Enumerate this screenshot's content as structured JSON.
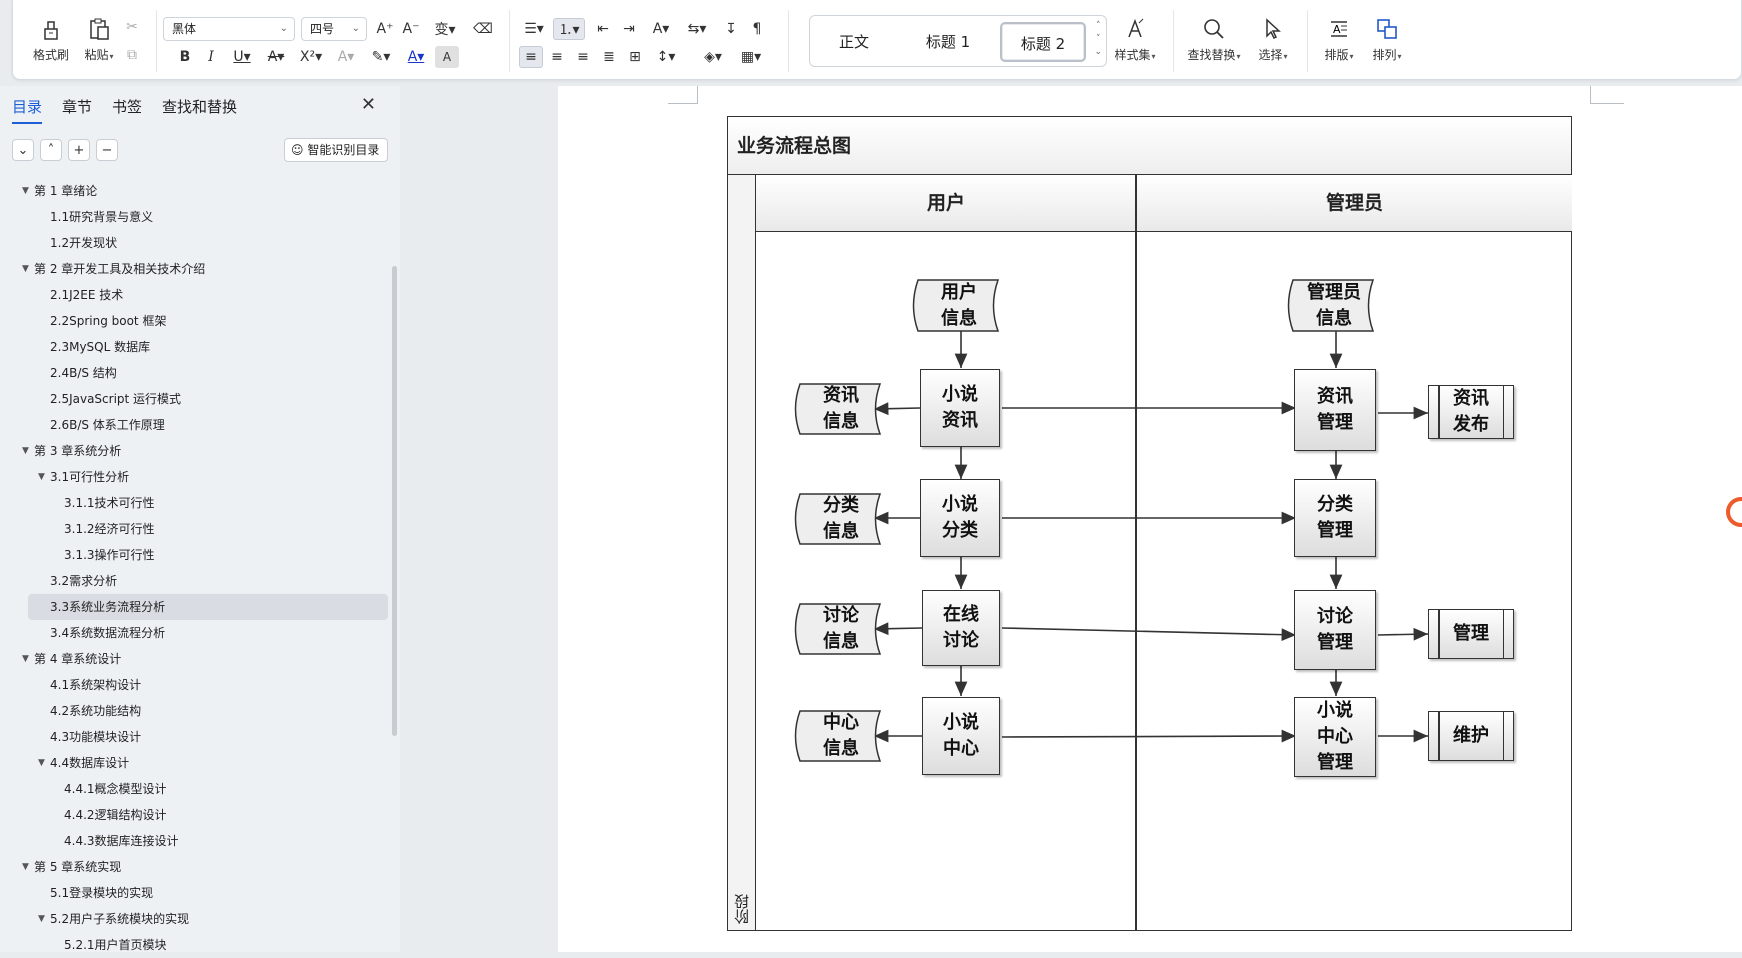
{
  "ribbon": {
    "format_brush": "格式刷",
    "paste": "粘贴",
    "font_name": "黑体",
    "font_size": "四号",
    "style_set": "样式集",
    "find_replace": "查找替换",
    "select": "选择",
    "layout": "排版",
    "arrange": "排列",
    "styles": [
      "正文",
      "标题 1",
      "标题 2"
    ],
    "selected_style_index": 2
  },
  "sidebar": {
    "tabs": [
      "目录",
      "章节",
      "书签",
      "查找和替换"
    ],
    "active_tab": 0,
    "smart_toc": "智能识别目录",
    "toc": [
      {
        "label": "第 1 章绪论",
        "level": 1,
        "expanded": true
      },
      {
        "label": "1.1研究背景与意义",
        "level": 2
      },
      {
        "label": "1.2开发现状",
        "level": 2
      },
      {
        "label": "第 2 章开发工具及相关技术介绍",
        "level": 1,
        "expanded": true
      },
      {
        "label": "2.1J2EE 技术",
        "level": 2
      },
      {
        "label": "2.2Spring boot 框架",
        "level": 2
      },
      {
        "label": "2.3MySQL 数据库",
        "level": 2
      },
      {
        "label": "2.4B/S 结构",
        "level": 2
      },
      {
        "label": "2.5JavaScript  运行模式",
        "level": 2
      },
      {
        "label": "2.6B/S 体系工作原理",
        "level": 2
      },
      {
        "label": "第 3 章系统分析",
        "level": 1,
        "expanded": true
      },
      {
        "label": "3.1可行性分析",
        "level": 2,
        "expanded": true
      },
      {
        "label": "3.1.1技术可行性",
        "level": 3
      },
      {
        "label": "3.1.2经济可行性",
        "level": 3
      },
      {
        "label": "3.1.3操作可行性",
        "level": 3
      },
      {
        "label": "3.2需求分析",
        "level": 2
      },
      {
        "label": "3.3系统业务流程分析",
        "level": 2,
        "selected": true
      },
      {
        "label": "3.4系统数据流程分析",
        "level": 2
      },
      {
        "label": "第 4 章系统设计",
        "level": 1,
        "expanded": true
      },
      {
        "label": "4.1系统架构设计",
        "level": 2
      },
      {
        "label": "4.2系统功能结构",
        "level": 2
      },
      {
        "label": "4.3功能模块设计",
        "level": 2
      },
      {
        "label": "4.4数据库设计",
        "level": 2,
        "expanded": true
      },
      {
        "label": "4.4.1概念模型设计",
        "level": 3
      },
      {
        "label": "4.4.2逻辑结构设计",
        "level": 3
      },
      {
        "label": "4.4.3数据库连接设计",
        "level": 3
      },
      {
        "label": "第 5 章系统实现",
        "level": 1,
        "expanded": true
      },
      {
        "label": "5.1登录模块的实现",
        "level": 2
      },
      {
        "label": "5.2用户子系统模块的实现",
        "level": 2,
        "expanded": true
      },
      {
        "label": "5.2.1用户首页模块",
        "level": 3
      }
    ]
  },
  "flowchart": {
    "title": "业务流程总图",
    "phase_label": "阶段",
    "lanes": [
      "用户",
      "管理员"
    ],
    "user_start": "用户信息",
    "admin_start": "管理员信息",
    "rows": [
      {
        "data": "资讯信息",
        "user": "小说资讯",
        "admin": "资讯管理",
        "result": "资讯发布"
      },
      {
        "data": "分类信息",
        "user": "小说分类",
        "admin": "分类管理",
        "result": ""
      },
      {
        "data": "讨论信息",
        "user": "在线讨论",
        "admin": "讨论管理",
        "result": "管理"
      },
      {
        "data": "中心信息",
        "user": "小说中心",
        "admin": "小说中心管理",
        "result": "维护"
      }
    ]
  }
}
